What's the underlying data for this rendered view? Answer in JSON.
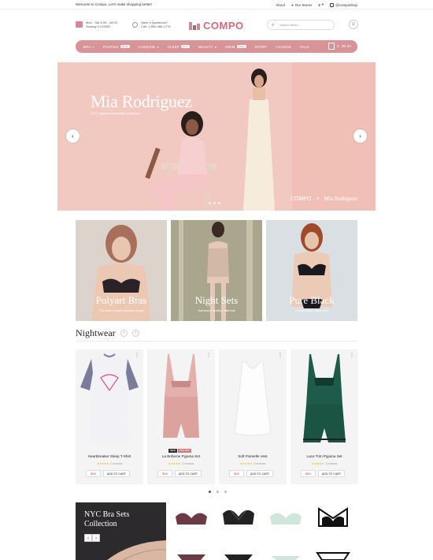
{
  "topbar": {
    "welcome": "Welcome to Compo, Let's make shopping better!",
    "about": "About",
    "stores": "Our Stores",
    "currency": "$",
    "social": "@composhop"
  },
  "header": {
    "hours_line1": "Mon - Sat 8:00 - 18:00",
    "hours_line2": "Sunday CLOSED",
    "question_line1": "Have a Questions?",
    "question_line2": "Call: 1-800-486-1776",
    "logo": "COMPO",
    "search_placeholder": "Search items..."
  },
  "nav": {
    "items": [
      {
        "label": "BRA",
        "badge": ""
      },
      {
        "label": "PANTIES",
        "badge": "NEW"
      },
      {
        "label": "LINGERIE",
        "badge": ""
      },
      {
        "label": "SLEEP",
        "badge": "HOT"
      },
      {
        "label": "BEAUTY",
        "badge": ""
      },
      {
        "label": "SWIM",
        "badge": "NEW"
      },
      {
        "label": "SPORT",
        "badge": ""
      },
      {
        "label": "LOUNGE",
        "badge": ""
      },
      {
        "label": "SALE",
        "badge": ""
      }
    ],
    "cart_total": "$0.00",
    "cart_count": "0"
  },
  "hero": {
    "title": "Mia Rodriguez",
    "subtitle": "SS17 Inspired Minimalist Collection",
    "brand": "COMPO",
    "collab": "Mia Rodriguez"
  },
  "categories": [
    {
      "title": "Polyart Bras",
      "sub": "The best of world famous brand"
    },
    {
      "title": "Night Sets",
      "sub": "Awesome quality materials"
    },
    {
      "title": "Pure Black",
      "sub": "Trendy black underwear"
    }
  ],
  "section": {
    "title": "Nightwear"
  },
  "products": [
    {
      "name": "Heartbreaker Sleep T-Shirt",
      "reviews": "0 reviews",
      "price": "$59",
      "cta": "ADD TO CART",
      "tags": []
    },
    {
      "name": "La Boheme Pyjama Set",
      "reviews": "0 reviews",
      "price": "$59",
      "cta": "ADD TO CART",
      "tags": [
        "NEW",
        "20% OFF"
      ]
    },
    {
      "name": "Soft Pointelle Vest",
      "reviews": "0 reviews",
      "price": "$59",
      "cta": "ADD TO CART",
      "tags": []
    },
    {
      "name": "Lace Trim Pyjama Set",
      "reviews": "0 reviews",
      "price": "$59",
      "cta": "ADD TO CART",
      "tags": []
    }
  ],
  "collection": {
    "title_line1": "NYC Bra Sets",
    "title_line2": "Collection"
  },
  "colors": {
    "accent": "#d89397",
    "logo": "#d06c79",
    "hero": "#f2c9c0"
  }
}
